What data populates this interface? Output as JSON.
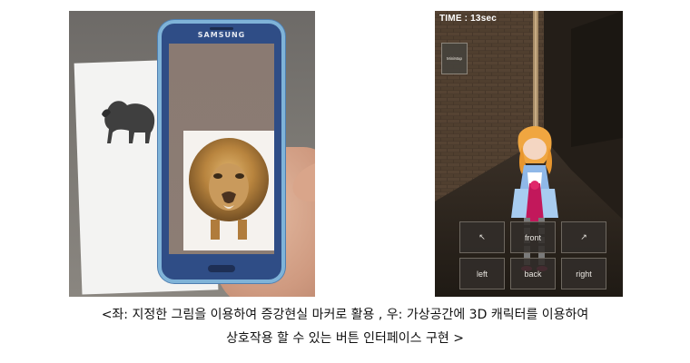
{
  "left_photo": {
    "phone_brand": "SAMSUNG"
  },
  "game": {
    "timer": "TIME : 13sec",
    "minimap_label": "MiniMap",
    "controls": [
      {
        "label": "↖",
        "icon": "arrow-up-left-icon"
      },
      {
        "label": "front"
      },
      {
        "label": "↗",
        "icon": "arrow-up-right-icon"
      },
      {
        "label": "left"
      },
      {
        "label": "back"
      },
      {
        "label": "right"
      }
    ]
  },
  "caption": {
    "line1": "<좌: 지정한 그림을 이용하여 증강현실 마커로 활용 , 우: 가상공간에 3D 캐릭터를 이용하여",
    "line2": "상호작용 할 수 있는 버튼 인터페이스 구현 >"
  }
}
